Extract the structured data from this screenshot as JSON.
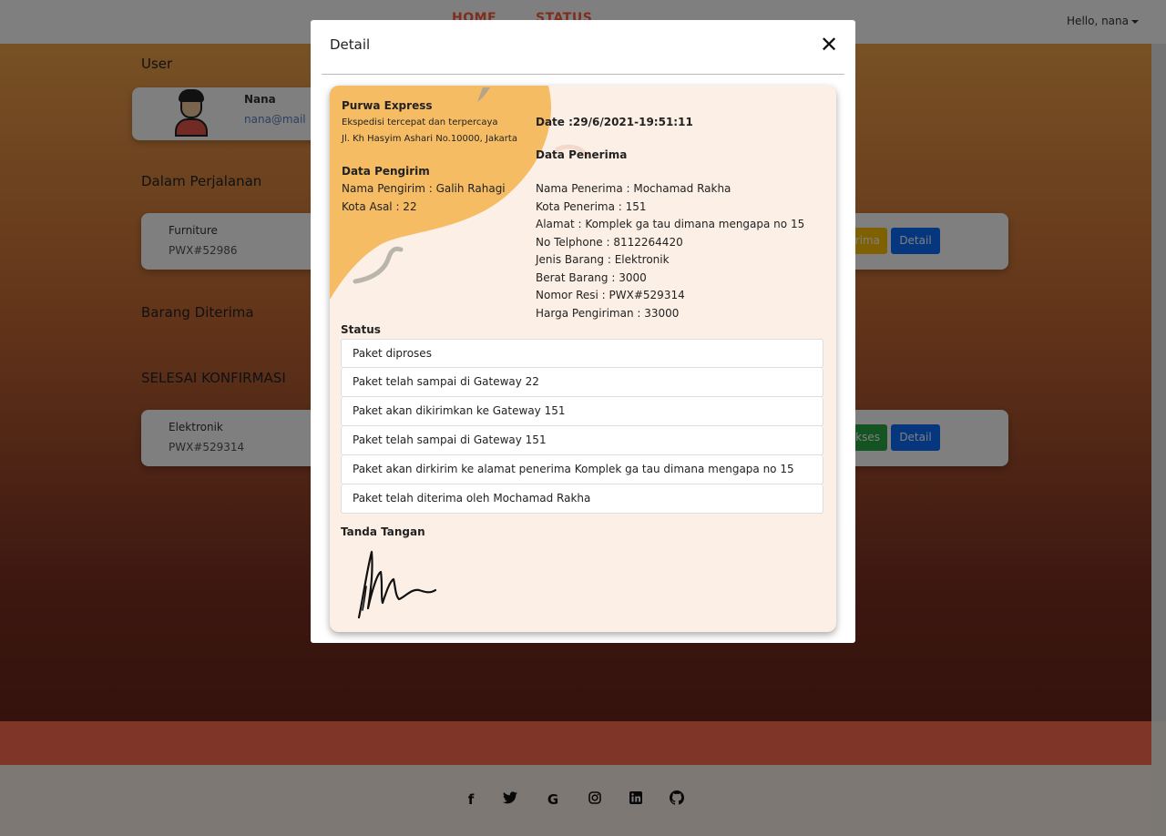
{
  "nav": {
    "home": "HOME",
    "status": "STATUS",
    "user_menu": "Hello, nana"
  },
  "sections": {
    "user": "User",
    "transit": "Dalam Perjalanan",
    "received": "Barang Diterima",
    "done": "SELESAI KONFIRMASI"
  },
  "user_card": {
    "name": "Nana",
    "email": "nana@mail"
  },
  "transit_item": {
    "name": "Furniture",
    "code": "PWX#52986",
    "action_label": "rima",
    "detail_label": "Detail"
  },
  "done_item": {
    "name": "Elektronik",
    "code": "PWX#529314",
    "action_label": "ukses",
    "detail_label": "Detail"
  },
  "footer_icons": [
    "facebook-icon",
    "twitter-icon",
    "google-icon",
    "instagram-icon",
    "linkedin-icon",
    "github-icon"
  ],
  "modal": {
    "title": "Detail",
    "close_icon": "close-icon",
    "company": {
      "name": "Purwa Express",
      "tagline": "Ekspedisi tercepat dan terpercaya",
      "address": "Jl. Kh Hasyim Ashari No.10000, Jakarta"
    },
    "date": "Date :29/6/2021-19:51:11",
    "sender": {
      "heading": "Data Pengirim",
      "name": "Nama Pengirim : Galih Rahagi",
      "city": "Kota Asal : 22"
    },
    "receiver": {
      "heading": "Data Penerima",
      "name": "Nama Penerima : Mochamad Rakha",
      "city": "Kota Penerima : 151",
      "address": "Alamat : Komplek ga tau dimana mengapa no 15",
      "phone": "No Telphone : 8112264420",
      "item_type": "Jenis Barang : Elektronik",
      "weight": "Berat Barang : 3000",
      "resi": "Nomor Resi : PWX#529314",
      "price": "Harga Pengiriman : 33000"
    },
    "status_heading": "Status",
    "status_items": [
      "Paket diproses",
      "Paket telah sampai di Gateway 22",
      "Paket akan dikirimkan ke Gateway 151",
      "Paket telah sampai di Gateway 151",
      "Paket akan dirkirim ke alamat penerima Komplek ga tau dimana mengapa no 15",
      "Paket telah diterima oleh Mochamad Rakha"
    ],
    "signature_heading": "Tanda Tangan"
  },
  "colors": {
    "accent": "#ff5a3c",
    "blob": "#f5bc63",
    "primary": "#0d6efd",
    "footer_band": "#ff6b50"
  }
}
